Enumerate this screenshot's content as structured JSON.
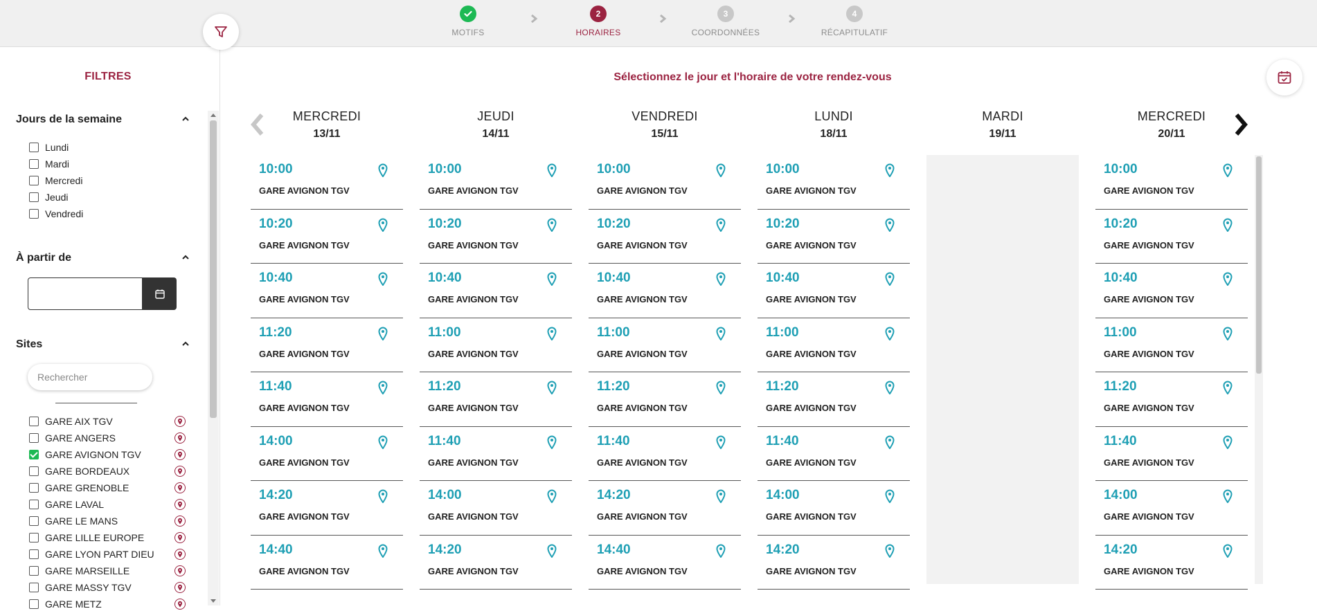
{
  "stepper": {
    "steps": [
      {
        "number": "",
        "label": "MOTIFS",
        "state": "done"
      },
      {
        "number": "2",
        "label": "HORAIRES",
        "state": "active"
      },
      {
        "number": "3",
        "label": "COORDONNÉES",
        "state": "todo"
      },
      {
        "number": "4",
        "label": "RÉCAPITULATIF",
        "state": "todo"
      }
    ]
  },
  "sidebar": {
    "title": "FILTRES",
    "weekdays": {
      "title": "Jours de la semaine",
      "items": [
        "Lundi",
        "Mardi",
        "Mercredi",
        "Jeudi",
        "Vendredi"
      ]
    },
    "from_date": {
      "title": "À partir de",
      "value": ""
    },
    "sites": {
      "title": "Sites",
      "search_placeholder": "Rechercher",
      "items": [
        {
          "label": "GARE AIX TGV",
          "checked": false
        },
        {
          "label": "GARE ANGERS",
          "checked": false
        },
        {
          "label": "GARE AVIGNON TGV",
          "checked": true
        },
        {
          "label": "GARE BORDEAUX",
          "checked": false
        },
        {
          "label": "GARE GRENOBLE",
          "checked": false
        },
        {
          "label": "GARE LAVAL",
          "checked": false
        },
        {
          "label": "GARE LE MANS",
          "checked": false
        },
        {
          "label": "GARE LILLE EUROPE",
          "checked": false
        },
        {
          "label": "GARE LYON PART DIEU",
          "checked": false
        },
        {
          "label": "GARE MARSEILLE",
          "checked": false
        },
        {
          "label": "GARE MASSY TGV",
          "checked": false
        },
        {
          "label": "GARE METZ",
          "checked": false
        }
      ]
    }
  },
  "main": {
    "title": "Sélectionnez le jour et l'horaire de votre rendez-vous",
    "days": [
      {
        "name": "MERCREDI",
        "date": "13/11",
        "slots": [
          {
            "time": "10:00",
            "site": "GARE AVIGNON TGV"
          },
          {
            "time": "10:20",
            "site": "GARE AVIGNON TGV"
          },
          {
            "time": "10:40",
            "site": "GARE AVIGNON TGV"
          },
          {
            "time": "11:20",
            "site": "GARE AVIGNON TGV"
          },
          {
            "time": "11:40",
            "site": "GARE AVIGNON TGV"
          },
          {
            "time": "14:00",
            "site": "GARE AVIGNON TGV"
          },
          {
            "time": "14:20",
            "site": "GARE AVIGNON TGV"
          },
          {
            "time": "14:40",
            "site": "GARE AVIGNON TGV"
          }
        ]
      },
      {
        "name": "JEUDI",
        "date": "14/11",
        "slots": [
          {
            "time": "10:00",
            "site": "GARE AVIGNON TGV"
          },
          {
            "time": "10:20",
            "site": "GARE AVIGNON TGV"
          },
          {
            "time": "10:40",
            "site": "GARE AVIGNON TGV"
          },
          {
            "time": "11:00",
            "site": "GARE AVIGNON TGV"
          },
          {
            "time": "11:20",
            "site": "GARE AVIGNON TGV"
          },
          {
            "time": "11:40",
            "site": "GARE AVIGNON TGV"
          },
          {
            "time": "14:00",
            "site": "GARE AVIGNON TGV"
          },
          {
            "time": "14:20",
            "site": "GARE AVIGNON TGV"
          }
        ]
      },
      {
        "name": "VENDREDI",
        "date": "15/11",
        "slots": [
          {
            "time": "10:00",
            "site": "GARE AVIGNON TGV"
          },
          {
            "time": "10:20",
            "site": "GARE AVIGNON TGV"
          },
          {
            "time": "10:40",
            "site": "GARE AVIGNON TGV"
          },
          {
            "time": "11:00",
            "site": "GARE AVIGNON TGV"
          },
          {
            "time": "11:20",
            "site": "GARE AVIGNON TGV"
          },
          {
            "time": "11:40",
            "site": "GARE AVIGNON TGV"
          },
          {
            "time": "14:20",
            "site": "GARE AVIGNON TGV"
          },
          {
            "time": "14:40",
            "site": "GARE AVIGNON TGV"
          }
        ]
      },
      {
        "name": "LUNDI",
        "date": "18/11",
        "slots": [
          {
            "time": "10:00",
            "site": "GARE AVIGNON TGV"
          },
          {
            "time": "10:20",
            "site": "GARE AVIGNON TGV"
          },
          {
            "time": "10:40",
            "site": "GARE AVIGNON TGV"
          },
          {
            "time": "11:00",
            "site": "GARE AVIGNON TGV"
          },
          {
            "time": "11:20",
            "site": "GARE AVIGNON TGV"
          },
          {
            "time": "11:40",
            "site": "GARE AVIGNON TGV"
          },
          {
            "time": "14:00",
            "site": "GARE AVIGNON TGV"
          },
          {
            "time": "14:20",
            "site": "GARE AVIGNON TGV"
          }
        ]
      },
      {
        "name": "MARDI",
        "date": "19/11",
        "slots": []
      },
      {
        "name": "MERCREDI",
        "date": "20/11",
        "slots": [
          {
            "time": "10:00",
            "site": "GARE AVIGNON TGV"
          },
          {
            "time": "10:20",
            "site": "GARE AVIGNON TGV"
          },
          {
            "time": "10:40",
            "site": "GARE AVIGNON TGV"
          },
          {
            "time": "11:00",
            "site": "GARE AVIGNON TGV"
          },
          {
            "time": "11:20",
            "site": "GARE AVIGNON TGV"
          },
          {
            "time": "11:40",
            "site": "GARE AVIGNON TGV"
          },
          {
            "time": "14:00",
            "site": "GARE AVIGNON TGV"
          },
          {
            "time": "14:20",
            "site": "GARE AVIGNON TGV"
          }
        ]
      }
    ]
  },
  "icons": {
    "done_step": "check-icon",
    "filter": "filter-icon",
    "calendar": "calendar-check-icon",
    "location": "map-pin-icon",
    "site_location": "map-pin-circle-icon"
  },
  "colors": {
    "brand": "#9b2341",
    "accent": "#1e9fb4",
    "success": "#1db954"
  }
}
